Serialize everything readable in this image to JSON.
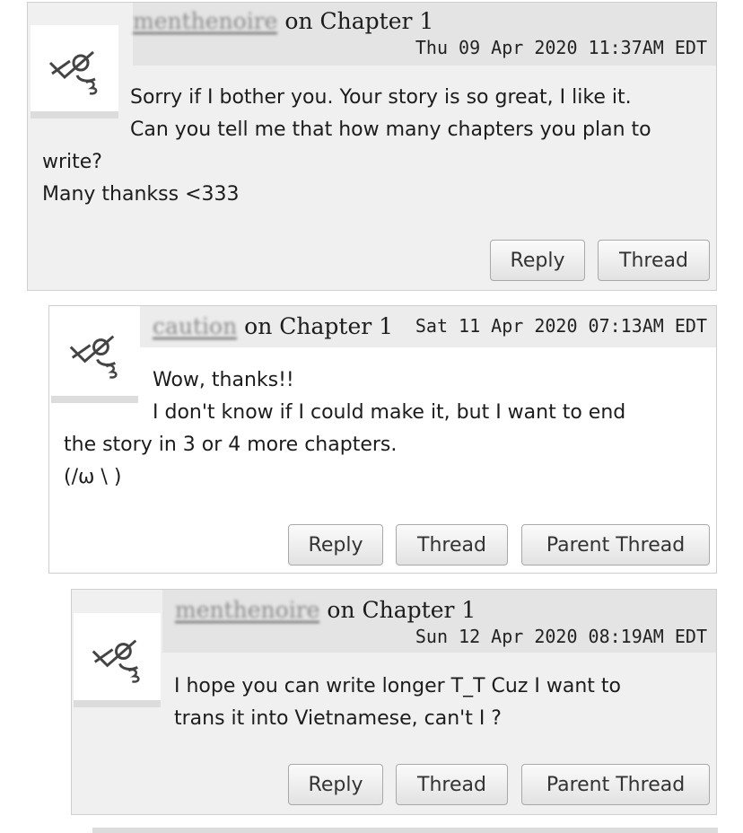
{
  "comments": [
    {
      "author": "menthenoire",
      "on_text": "on Chapter 1",
      "timestamp": "Thu 09 Apr 2020 11:37AM EDT",
      "lines": [
        "Sorry if I bother you. Your story is so great, I like it.",
        "Can you tell me that how many chapters you plan to",
        "write?",
        "Many thankss <333"
      ],
      "buttons": [
        "Reply",
        "Thread"
      ]
    },
    {
      "author": "caution",
      "on_text": "on Chapter 1",
      "timestamp": "Sat 11 Apr 2020 07:13AM EDT",
      "lines": [
        "Wow, thanks!!",
        "I don't know if I could make it, but I want to end",
        "the story in 3 or 4 more chapters.",
        "(/ω \\ )"
      ],
      "buttons": [
        "Reply",
        "Thread",
        "Parent Thread"
      ]
    },
    {
      "author": "menthenoire",
      "on_text": "on Chapter 1",
      "timestamp": "Sun 12 Apr 2020 08:19AM EDT",
      "lines": [
        "I hope you can write longer T_T Cuz I want to",
        "trans it into Vietnamese, can't I ?"
      ],
      "buttons": [
        "Reply",
        "Thread",
        "Parent Thread"
      ]
    }
  ]
}
